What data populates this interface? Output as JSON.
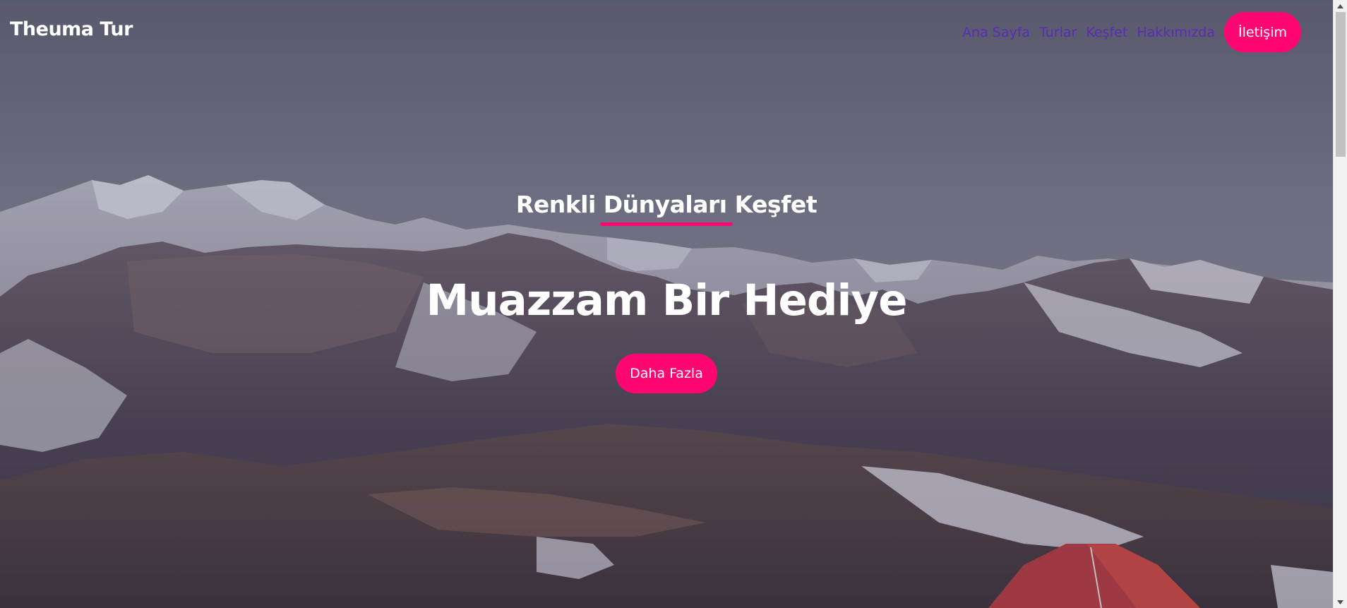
{
  "brand": "Theuma Tur",
  "nav": {
    "links": [
      "Ana Sayfa",
      "Turlar",
      "Keşfet",
      "Hakkımızda"
    ],
    "cta": "İletişim"
  },
  "hero": {
    "subtitle": "Renkli Dünyaları Keşfet",
    "title": "Muazzam Bir Hediye",
    "button": "Daha Fazla"
  },
  "colors": {
    "accent": "#fe0772",
    "nav_link": "#5b2bb5",
    "text": "#ffffff"
  },
  "icons": {
    "scroll_up": "triangle-up-icon",
    "scroll_down": "triangle-down-icon"
  }
}
